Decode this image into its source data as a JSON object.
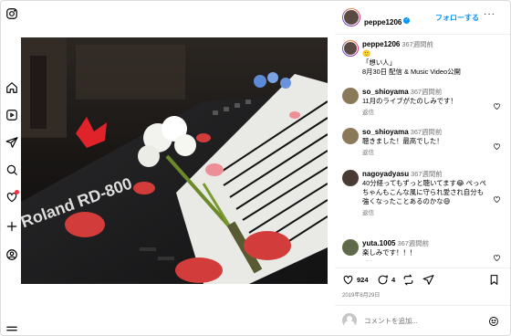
{
  "post": {
    "username": "peppe1206",
    "follow_label": "フォローする",
    "more_label": "···",
    "caption": {
      "time": "367週間前",
      "line1": "🙂",
      "line2": "「想い人」",
      "line3": "8月30日 配信 & Music Video公開"
    },
    "likes": "924",
    "comments_count": "4",
    "date": "2019年8月29日",
    "comment_placeholder": "コメントを追加..."
  },
  "comments": [
    {
      "user": "so_shioyama",
      "time": "367週間前",
      "text": "11月のライブがたのしみです！",
      "reply": "返信"
    },
    {
      "user": "so_shioyama",
      "time": "367週間前",
      "text": "聴きました！最高でした！",
      "reply": "返信"
    },
    {
      "user": "nagoyadyasu",
      "time": "367週間前",
      "text": "40分経ってもずっと聴いてます😂 ぺっぺちゃんもこんな風に守られ愛され自分も強くなったことあるのかな😄",
      "reply": "返信"
    },
    {
      "user": "yuta.1005",
      "time": "367週間前",
      "text": "楽しみです！！！",
      "reply": "返信"
    }
  ],
  "keyboard_brand": "Roland RD-800",
  "colors": {
    "accent": "#0095f6",
    "notification": "#ff3040"
  }
}
